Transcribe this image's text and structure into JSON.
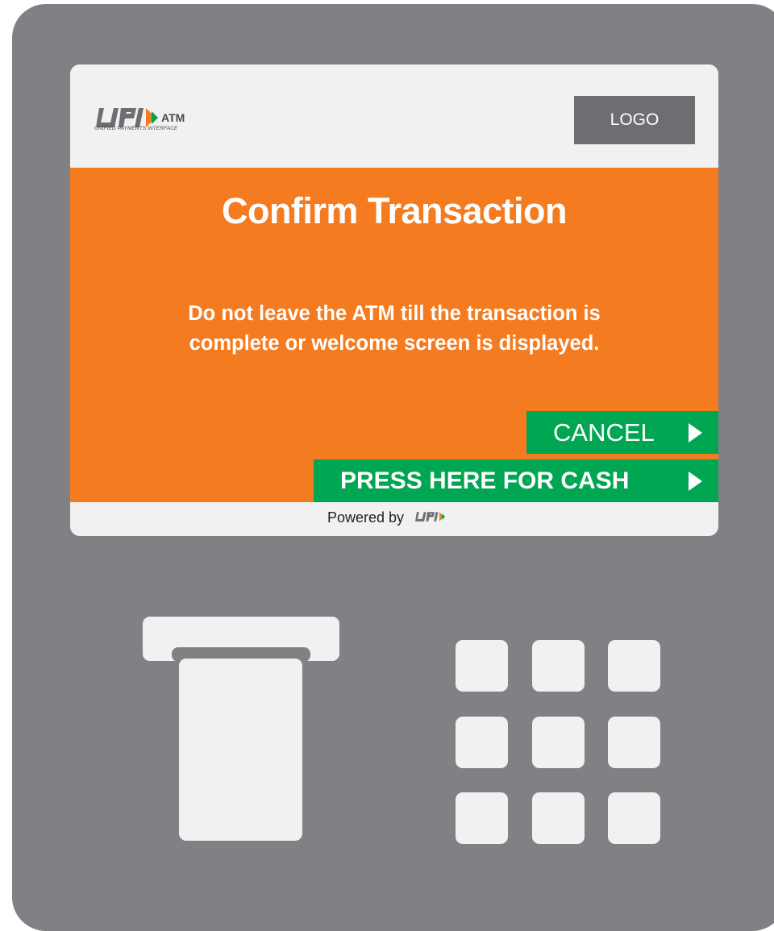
{
  "header": {
    "upi_logo_text": "ATM",
    "upi_logo_subtitle": "UNIFIED PAYMENTS INTERFACE",
    "bank_logo_label": "LOGO"
  },
  "main": {
    "title": "Confirm Transaction",
    "message_line1": "Do not leave the ATM till the transaction is",
    "message_line2": "complete or welcome screen is displayed."
  },
  "actions": {
    "cancel_label": "CANCEL",
    "cash_label": "PRESS HERE FOR CASH"
  },
  "footer": {
    "powered_by": "Powered by"
  },
  "colors": {
    "atm_body": "#808184",
    "screen_bg": "#f1f1f1",
    "accent_orange": "#f47b20",
    "button_green": "#00a651",
    "logo_box": "#6d6e71"
  },
  "icons": {
    "upi_logo": "upi-logo-icon",
    "arrow": "chevron-right-icon"
  }
}
